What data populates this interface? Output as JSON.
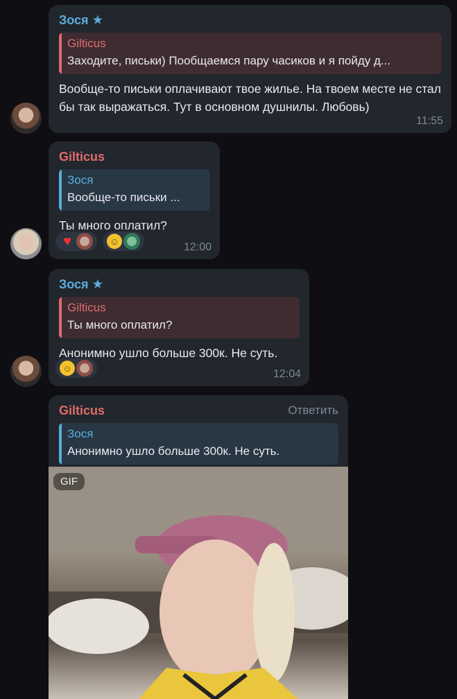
{
  "messages": [
    {
      "sender": "Зося",
      "quote_name": "Gilticus",
      "quote_text": "Заходите, письки) Пообщаемся пару часиков и я пойду д...",
      "text": "Вообще-то письки оплачивают твое жилье. На твоем месте не стал бы так выражаться. Тут в основном душнилы. Любовь)",
      "time": "11:55",
      "star_icon": "star-icon"
    },
    {
      "sender": "Gilticus",
      "quote_name": "Зося",
      "quote_text": "Вообще-то письки ...",
      "text": "Ты много оплатил?",
      "time": "12:00"
    },
    {
      "sender": "Зося",
      "quote_name": "Gilticus",
      "quote_text": "Ты много оплатил?",
      "text": "Анонимно ушло больше 300к. Не суть.",
      "time": "12:04",
      "star_icon": "star-icon"
    },
    {
      "sender": "Gilticus",
      "reply_label": "Ответить",
      "quote_name": "Зося",
      "quote_text": "Анонимно ушло больше 300к. Не суть.",
      "gif_label": "GIF"
    }
  ],
  "colors": {
    "background": "#0e0e13",
    "bubble": "#22262d",
    "sender_blue": "#5aaedc",
    "sender_red": "#e06b6b",
    "timestamp": "#7f8896"
  }
}
